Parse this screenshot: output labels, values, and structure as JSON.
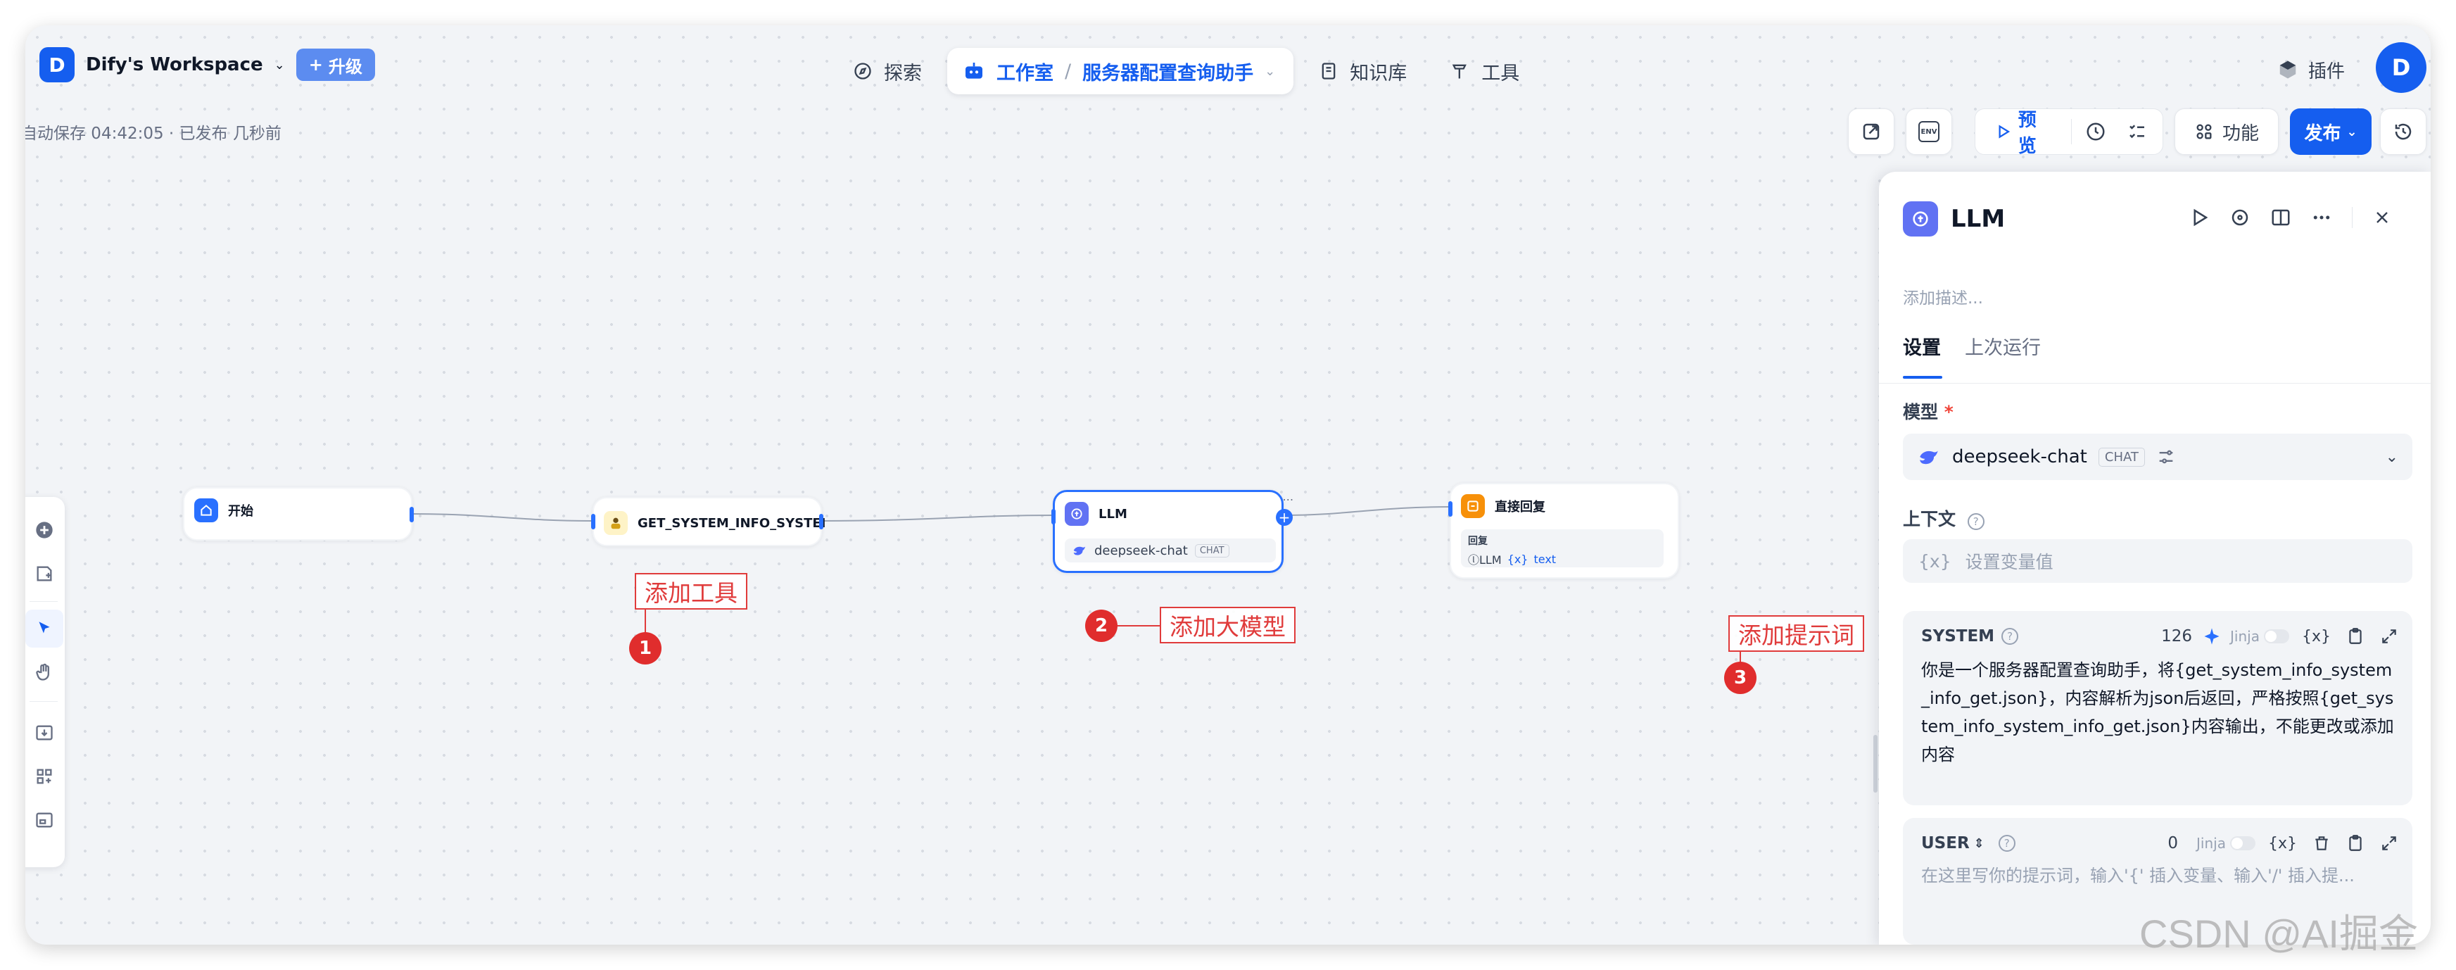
{
  "workspace": {
    "avatar": "D",
    "name": "Dify's Workspace",
    "upgrade_label": "升级"
  },
  "nav": {
    "explore": "探索",
    "studio": "工作室",
    "app_name": "服务器配置查询助手",
    "knowledge": "知识库",
    "tools": "工具"
  },
  "plugins_label": "插件",
  "user_avatar": "D",
  "autosave": "自动保存 04:42:05 · 已发布 几秒前",
  "toolbar": {
    "env_label": "ENV",
    "preview_label": "预览",
    "features_label": "功能",
    "publish_label": "发布"
  },
  "nodes": {
    "start": {
      "title": "开始"
    },
    "tool": {
      "title": "GET_SYSTEM_INFO_SYSTEI"
    },
    "llm": {
      "title": "LLM",
      "model": "deepseek-chat",
      "model_badge": "CHAT"
    },
    "reply": {
      "title": "直接回复",
      "section_label": "回复",
      "var_node": "LLM",
      "var_prefix": "{x}",
      "var_name": "text"
    }
  },
  "annotations": {
    "a1_label": "添加工具",
    "a1_num": "1",
    "a2_label": "添加大模型",
    "a2_num": "2",
    "a3_label": "添加提示词",
    "a3_num": "3"
  },
  "panel": {
    "title": "LLM",
    "description_placeholder": "添加描述...",
    "tabs": {
      "settings": "设置",
      "last_run": "上次运行"
    },
    "model_label": "模型",
    "required_mark": "*",
    "model_name": "deepseek-chat",
    "model_badge": "CHAT",
    "context_label": "上下文",
    "context_prefix": "{x}",
    "context_placeholder": "设置变量值",
    "system": {
      "role": "SYSTEM",
      "count": "126",
      "jinja": "Jinja",
      "var_icon_text": "{x}",
      "text": "你是一个服务器配置查询助手，将{get_system_info_system_info_get.json}，内容解析为json后返回，严格按照{get_system_info_system_info_get.json}内容输出，不能更改或添加内容"
    },
    "user": {
      "role": "USER",
      "count": "0",
      "jinja": "Jinja",
      "var_icon_text": "{x}",
      "placeholder": "在这里写你的提示词，输入'{' 插入变量、输入'/' 插入提..."
    }
  },
  "watermark": "CSDN @AI掘金",
  "colors": {
    "accent": "#155eef",
    "annotation": "#e03b3b"
  }
}
